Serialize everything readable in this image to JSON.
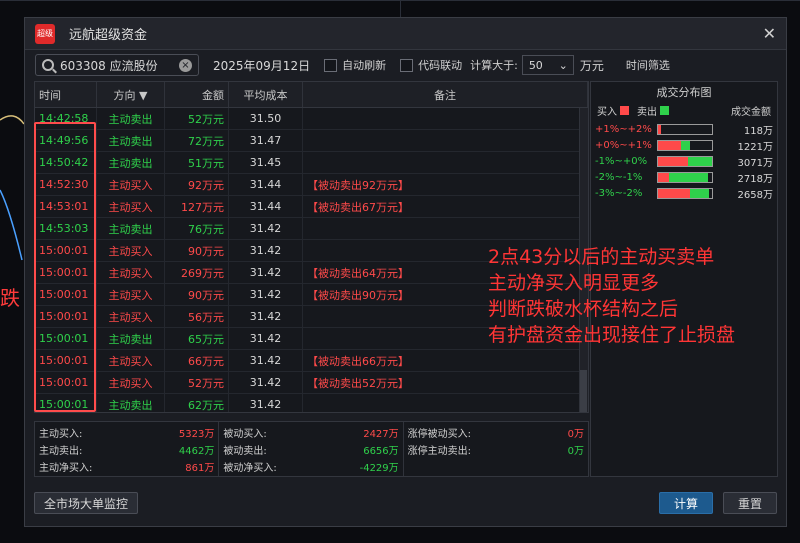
{
  "background": {
    "side_text": "跌"
  },
  "window": {
    "title": "远航超级资金",
    "app_icon_text": "超级"
  },
  "toolbar": {
    "search_value": "603308 应流股份",
    "date": "2025年09月12日",
    "auto_refresh_label": "自动刷新",
    "code_link_label": "代码联动",
    "calc_label": "计算大于:",
    "calc_value": "50",
    "unit": "万元",
    "time_filter": "时间筛选"
  },
  "table": {
    "headers": {
      "time": "时间",
      "direction": "方向 ▼",
      "amount": "金额",
      "avg_cost": "平均成本",
      "note": "备注"
    },
    "rows": [
      {
        "time": "14:42:58",
        "dir": "主动卖出",
        "amount": "52万元",
        "cost": "31.50",
        "note": "",
        "time_color": "green",
        "dir_color": "green",
        "amt_color": "green"
      },
      {
        "time": "14:49:56",
        "dir": "主动卖出",
        "amount": "72万元",
        "cost": "31.47",
        "note": "",
        "time_color": "green",
        "dir_color": "green",
        "amt_color": "green"
      },
      {
        "time": "14:50:42",
        "dir": "主动卖出",
        "amount": "51万元",
        "cost": "31.45",
        "note": "",
        "time_color": "green",
        "dir_color": "green",
        "amt_color": "green"
      },
      {
        "time": "14:52:30",
        "dir": "主动买入",
        "amount": "92万元",
        "cost": "31.44",
        "note": "【被动卖出92万元】",
        "time_color": "red",
        "dir_color": "red",
        "amt_color": "red"
      },
      {
        "time": "14:53:01",
        "dir": "主动买入",
        "amount": "127万元",
        "cost": "31.44",
        "note": "【被动卖出67万元】",
        "time_color": "red",
        "dir_color": "red",
        "amt_color": "red"
      },
      {
        "time": "14:53:03",
        "dir": "主动卖出",
        "amount": "76万元",
        "cost": "31.42",
        "note": "",
        "time_color": "green",
        "dir_color": "green",
        "amt_color": "green"
      },
      {
        "time": "15:00:01",
        "dir": "主动买入",
        "amount": "90万元",
        "cost": "31.42",
        "note": "",
        "time_color": "red",
        "dir_color": "red",
        "amt_color": "red"
      },
      {
        "time": "15:00:01",
        "dir": "主动买入",
        "amount": "269万元",
        "cost": "31.42",
        "note": "【被动卖出64万元】",
        "time_color": "red",
        "dir_color": "red",
        "amt_color": "red"
      },
      {
        "time": "15:00:01",
        "dir": "主动买入",
        "amount": "90万元",
        "cost": "31.42",
        "note": "【被动卖出90万元】",
        "time_color": "red",
        "dir_color": "red",
        "amt_color": "red"
      },
      {
        "time": "15:00:01",
        "dir": "主动买入",
        "amount": "56万元",
        "cost": "31.42",
        "note": "",
        "time_color": "red",
        "dir_color": "red",
        "amt_color": "red"
      },
      {
        "time": "15:00:01",
        "dir": "主动卖出",
        "amount": "65万元",
        "cost": "31.42",
        "note": "",
        "time_color": "green",
        "dir_color": "green",
        "amt_color": "green"
      },
      {
        "time": "15:00:01",
        "dir": "主动买入",
        "amount": "66万元",
        "cost": "31.42",
        "note": "【被动卖出66万元】",
        "time_color": "red",
        "dir_color": "red",
        "amt_color": "red"
      },
      {
        "time": "15:00:01",
        "dir": "主动买入",
        "amount": "52万元",
        "cost": "31.42",
        "note": "【被动卖出52万元】",
        "time_color": "red",
        "dir_color": "red",
        "amt_color": "red"
      },
      {
        "time": "15:00:01",
        "dir": "主动卖出",
        "amount": "62万元",
        "cost": "31.42",
        "note": "",
        "time_color": "green",
        "dir_color": "green",
        "amt_color": "green"
      }
    ]
  },
  "distribution": {
    "title": "成交分布图",
    "buy_label": "买入",
    "sell_label": "卖出",
    "amount_header": "成交金额",
    "rows": [
      {
        "label": "+1%~+2%",
        "label_color": "red",
        "buy_frac": 0.05,
        "sell_frac": 0.0,
        "value": "118万"
      },
      {
        "label": "+0%~+1%",
        "label_color": "red",
        "buy_frac": 0.42,
        "sell_frac": 0.18,
        "value": "1221万"
      },
      {
        "label": "-1%~+0%",
        "label_color": "green",
        "buy_frac": 0.55,
        "sell_frac": 0.45,
        "value": "3071万"
      },
      {
        "label": "-2%~-1%",
        "label_color": "green",
        "buy_frac": 0.2,
        "sell_frac": 0.72,
        "value": "2718万"
      },
      {
        "label": "-3%~-2%",
        "label_color": "green",
        "buy_frac": 0.6,
        "sell_frac": 0.35,
        "value": "2658万"
      }
    ]
  },
  "summary": {
    "active_buy_label": "主动买入:",
    "active_buy": "5323万",
    "active_sell_label": "主动卖出:",
    "active_sell": "4462万",
    "active_net_label": "主动净买入:",
    "active_net": "861万",
    "passive_buy_label": "被动买入:",
    "passive_buy": "2427万",
    "passive_sell_label": "被动卖出:",
    "passive_sell": "6656万",
    "passive_net_label": "被动净买入:",
    "passive_net": "-4229万",
    "limit_passive_buy_label": "涨停被动买入:",
    "limit_passive_buy": "0万",
    "limit_active_sell_label": "涨停主动卖出:",
    "limit_active_sell": "0万"
  },
  "annotation": {
    "line1": "2点43分以后的主动买卖单",
    "line2": "主动净买入明显更多",
    "line3": "判断跌破水杯结构之后",
    "line4": "有护盘资金出现接住了止损盘"
  },
  "buttons": {
    "monitor": "全市场大单监控",
    "calc": "计算",
    "reset": "重置"
  },
  "colors": {
    "red": "#ff4a4a",
    "green": "#2fd14b",
    "accent": "#1d5a8e"
  }
}
